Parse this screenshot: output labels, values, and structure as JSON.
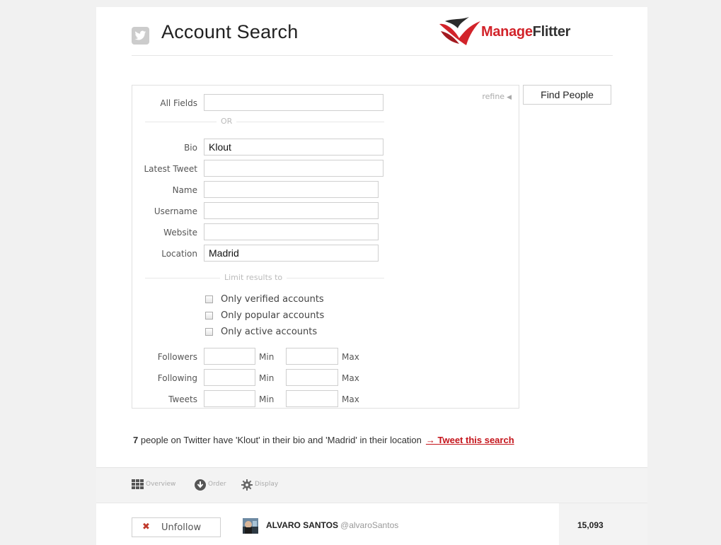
{
  "header": {
    "title": "Account Search",
    "logo_part1": "Manage",
    "logo_part2": "Flitter",
    "brand_color": "#d2232a"
  },
  "search": {
    "refine_label": "refine",
    "find_button": "Find People",
    "or_separator": "OR",
    "limit_separator": "Limit results to",
    "fields": {
      "all_fields": {
        "label": "All Fields",
        "value": ""
      },
      "bio": {
        "label": "Bio",
        "value": "Klout"
      },
      "latest_tweet": {
        "label": "Latest Tweet",
        "value": ""
      },
      "name": {
        "label": "Name",
        "value": ""
      },
      "username": {
        "label": "Username",
        "value": ""
      },
      "website": {
        "label": "Website",
        "value": ""
      },
      "location": {
        "label": "Location",
        "value": "Madrid"
      }
    },
    "checkboxes": [
      {
        "label": "Only verified accounts",
        "checked": false
      },
      {
        "label": "Only popular accounts",
        "checked": false
      },
      {
        "label": "Only active accounts",
        "checked": false
      }
    ],
    "ranges": [
      {
        "label": "Followers",
        "min_label": "Min",
        "max_label": "Max",
        "min": "",
        "max": ""
      },
      {
        "label": "Following",
        "min_label": "Min",
        "max_label": "Max",
        "min": "",
        "max": ""
      },
      {
        "label": "Tweets",
        "min_label": "Min",
        "max_label": "Max",
        "min": "",
        "max": ""
      }
    ]
  },
  "summary": {
    "count": "7",
    "text": " people on Twitter have 'Klout' in their bio and 'Madrid' in their location",
    "link": "→ Tweet this search"
  },
  "toolbar": {
    "overview": "Overview",
    "order": "Order",
    "display": "Display"
  },
  "results": [
    {
      "button": "Unfollow",
      "name": "ALVARO SANTOS",
      "handle": "@alvaroSantos",
      "count": "15,093"
    }
  ]
}
